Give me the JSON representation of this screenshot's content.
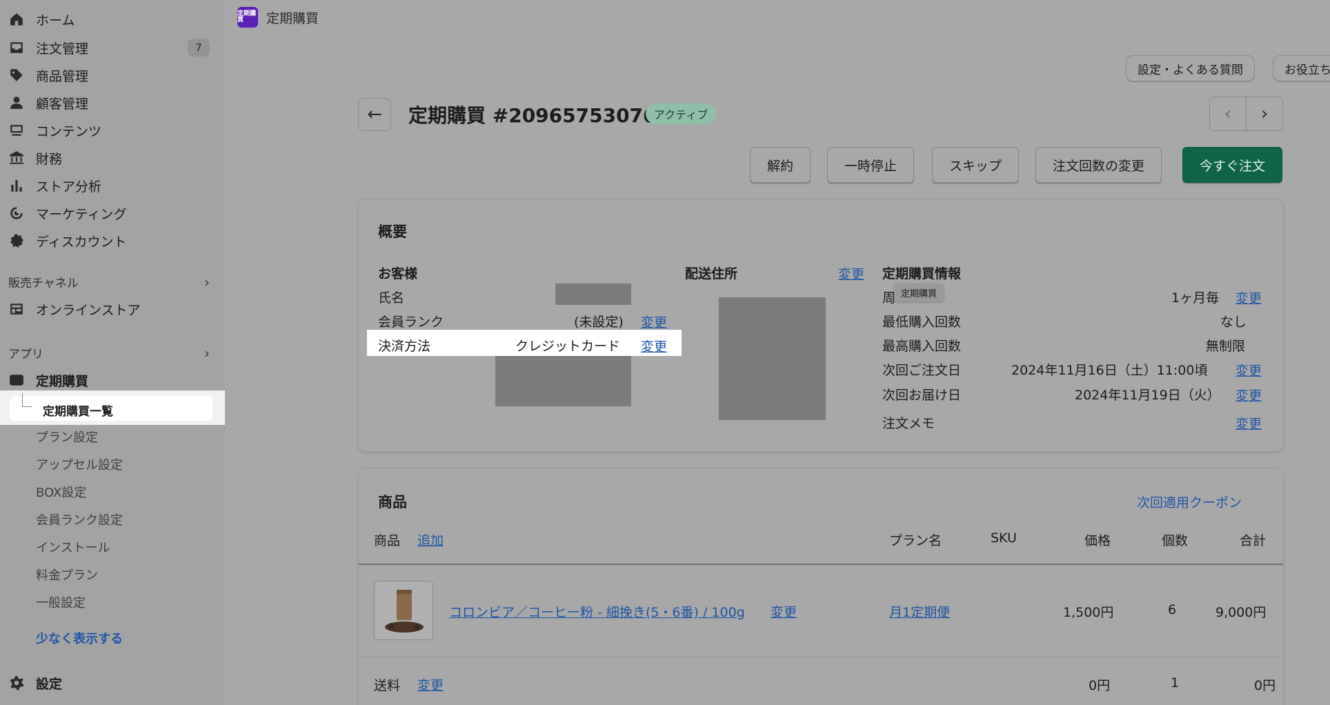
{
  "sidebar": {
    "nav": [
      {
        "label": "ホーム",
        "icon": "home-icon"
      },
      {
        "label": "注文管理",
        "icon": "inbox-icon",
        "badge": "7"
      },
      {
        "label": "商品管理",
        "icon": "tag-icon"
      },
      {
        "label": "顧客管理",
        "icon": "person-icon"
      },
      {
        "label": "コンテンツ",
        "icon": "content-icon"
      },
      {
        "label": "財務",
        "icon": "bank-icon"
      },
      {
        "label": "ストア分析",
        "icon": "chart-icon"
      },
      {
        "label": "マーケティング",
        "icon": "target-icon"
      },
      {
        "label": "ディスカウント",
        "icon": "discount-icon"
      }
    ],
    "sales_channel_label": "販売チャネル",
    "online_store": "オンラインストア",
    "apps_label": "アプリ",
    "app_name": "定期購買",
    "app_sub": {
      "selected": "定期購買一覧",
      "items": [
        "プラン設定",
        "アップセル設定",
        "BOX設定",
        "会員ランク設定",
        "インストール",
        "料金プラン",
        "一般設定"
      ]
    },
    "show_less": "少なく表示する",
    "settings": "設定"
  },
  "header": {
    "app_logo_text": "定期購買",
    "app_title": "定期購買",
    "faq_button": "設定・よくある質問",
    "help_button": "お役立ち"
  },
  "subscription": {
    "title": "定期購買 #20965753076",
    "status": "アクティブ",
    "actions": {
      "cancel": "解約",
      "pause": "一時停止",
      "skip": "スキップ",
      "change_count": "注文回数の変更",
      "order_now": "今すぐ注文"
    }
  },
  "summary": {
    "heading": "概要",
    "customer": {
      "heading": "お客様",
      "name_label": "氏名",
      "rank_label": "会員ランク",
      "rank_value": "(未設定)",
      "rank_change": "変更",
      "payment_label": "決済方法",
      "payment_value": "クレジットカード",
      "payment_change": "変更"
    },
    "shipping": {
      "heading": "配送住所",
      "change": "変更"
    },
    "info": {
      "heading": "定期購買情報",
      "cycle_label": "周",
      "cycle_tooltip": "定期購買",
      "cycle_value": "1ヶ月毎",
      "cycle_change": "変更",
      "min_label": "最低購入回数",
      "min_value": "なし",
      "max_label": "最高購入回数",
      "max_value": "無制限",
      "next_order_label": "次回ご注文日",
      "next_order_value": "2024年11月16日（土）11:00頃",
      "next_order_change": "変更",
      "next_delivery_label": "次回お届け日",
      "next_delivery_value": "2024年11月19日（火）",
      "next_delivery_change": "変更",
      "memo_label": "注文メモ",
      "memo_change": "変更"
    }
  },
  "products": {
    "heading": "商品",
    "coupon_link": "次回適用クーポン",
    "columns": {
      "product": "商品",
      "add": "追加",
      "plan": "プラン名",
      "sku": "SKU",
      "price": "価格",
      "qty": "個数",
      "total": "合計"
    },
    "rows": [
      {
        "name": "コロンビア／コーヒー粉 - 細挽き(5・6番) / 100g",
        "change": "変更",
        "plan": "月1定期便",
        "sku": "",
        "price": "1,500円",
        "qty": "6",
        "total": "9,000円"
      }
    ],
    "shipping_row": {
      "label": "送料",
      "change": "変更",
      "price": "0円",
      "qty": "1",
      "total": "0円"
    }
  }
}
